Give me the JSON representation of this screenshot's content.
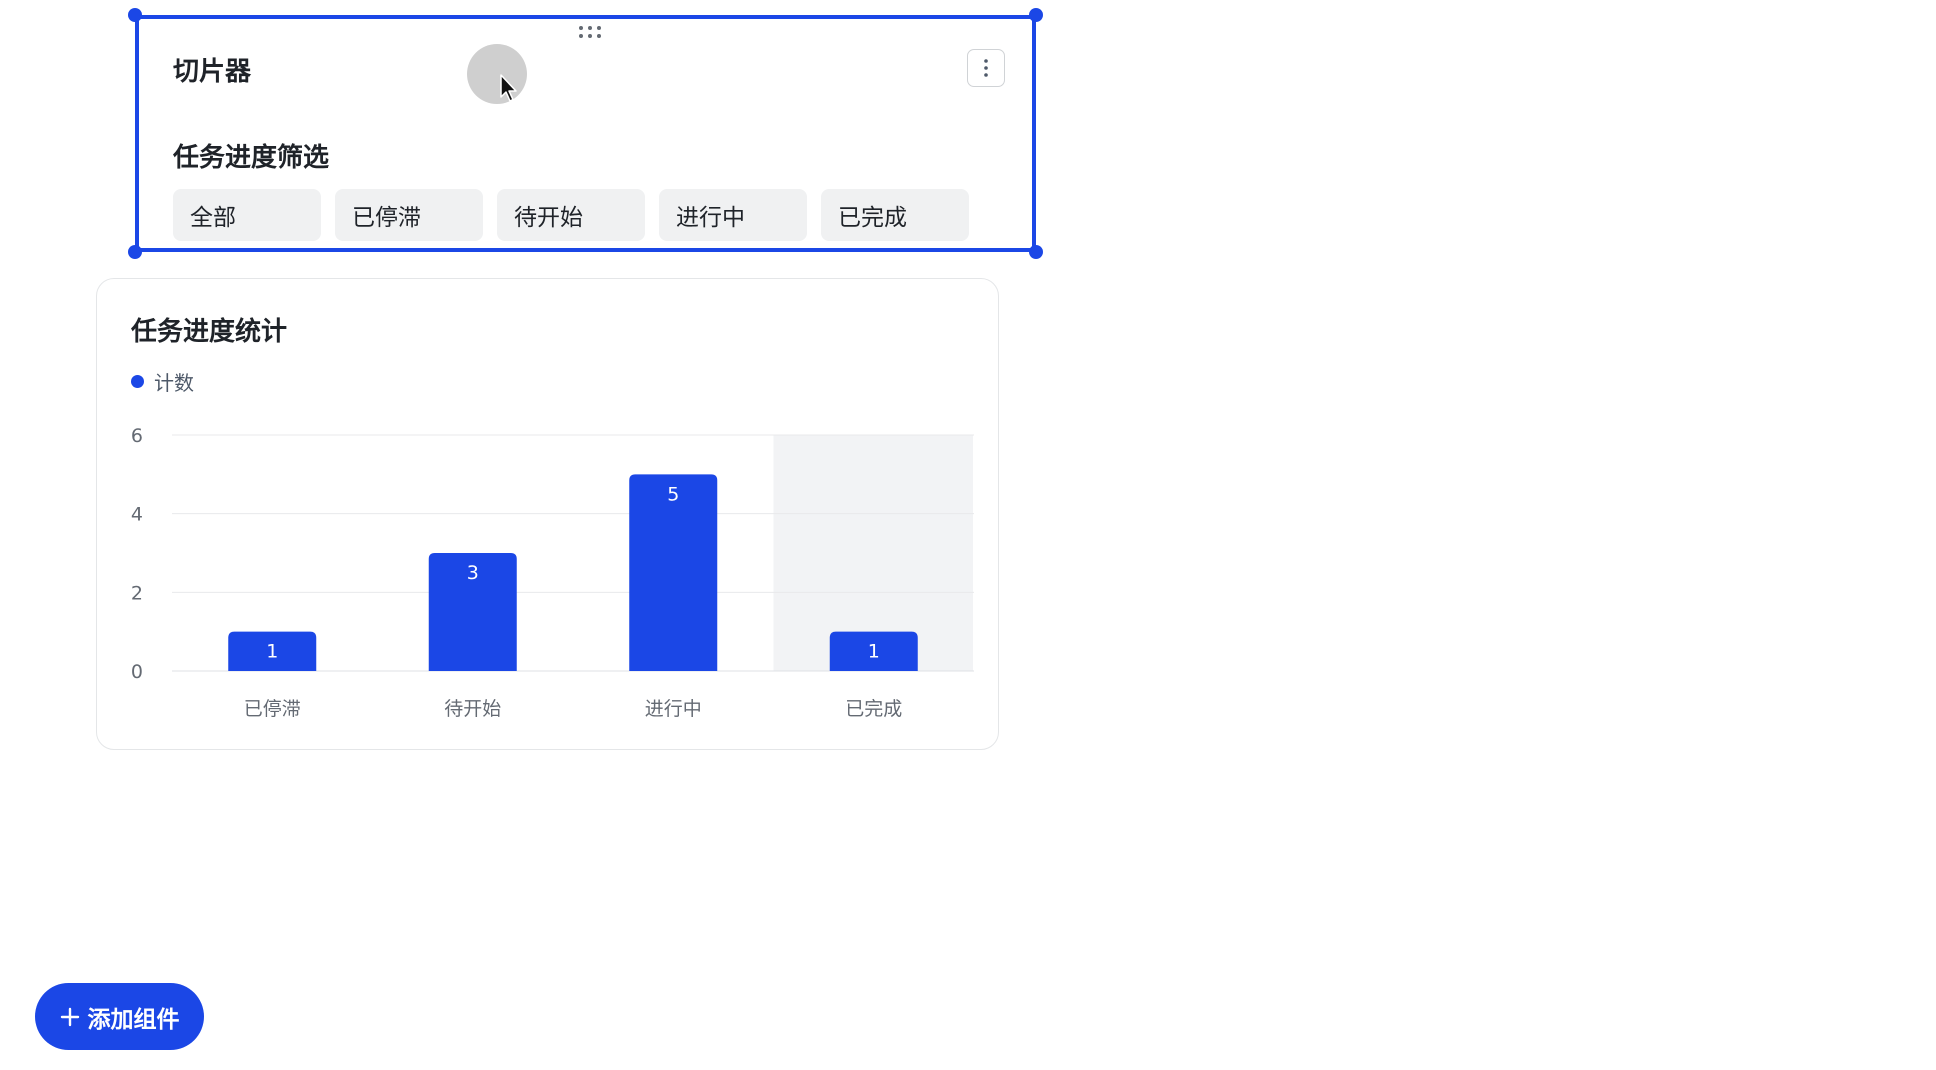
{
  "slicer": {
    "title": "切片器",
    "filter_title": "任务进度筛选",
    "options": [
      "全部",
      "已停滞",
      "待开始",
      "进行中",
      "已完成"
    ]
  },
  "chart": {
    "title": "任务进度统计",
    "legend": "计数",
    "accent_color": "#1b47e6"
  },
  "chart_data": {
    "type": "bar",
    "title": "任务进度统计",
    "categories": [
      "已停滞",
      "待开始",
      "进行中",
      "已完成"
    ],
    "series": [
      {
        "name": "计数",
        "values": [
          1,
          3,
          5,
          1
        ]
      }
    ],
    "ylim": [
      0,
      6
    ],
    "yticks": [
      0,
      2,
      4,
      6
    ],
    "grid": true,
    "legend_position": "top-left",
    "highlighted_category": "已完成"
  },
  "add_button": {
    "label": "添加组件",
    "icon": "plus-icon"
  },
  "icons": {
    "more": "more-vertical-icon",
    "drag": "drag-handle-icon",
    "cursor": "cursor-icon"
  }
}
